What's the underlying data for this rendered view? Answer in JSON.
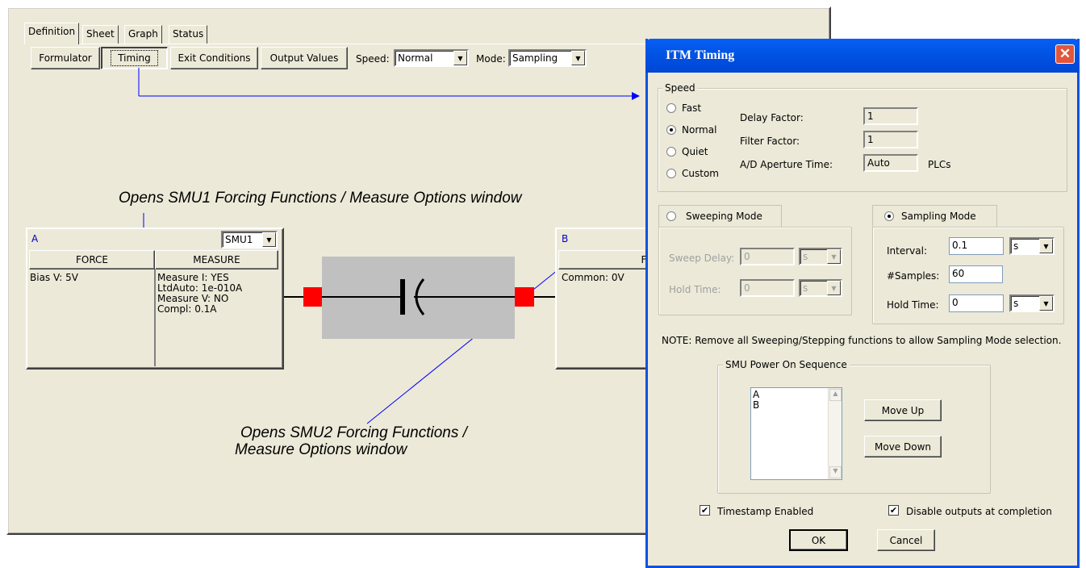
{
  "main": {
    "tabs": [
      "Definition",
      "Sheet",
      "Graph",
      "Status"
    ],
    "toolbar": {
      "formulator": "Formulator",
      "timing": "Timing",
      "exit_conditions": "Exit Conditions",
      "output_values": "Output Values",
      "speed_label": "Speed:",
      "speed_value": "Normal",
      "mode_label": "Mode:",
      "mode_value": "Sampling"
    },
    "annotations": {
      "smu1": "Opens SMU1 Forcing Functions / Measure Options window",
      "smu2_line1": "Opens SMU2 Forcing Functions /",
      "smu2_line2": "Measure Options window"
    },
    "smu_a": {
      "terminal": "A",
      "smu_select": "SMU1",
      "force_header": "FORCE",
      "measure_header": "MEASURE",
      "force_text": "Bias V: 5V",
      "measure_text": "Measure I: YES\nLtdAuto: 1e-010A\nMeasure V: NO\nCompl: 0.1A"
    },
    "smu_b": {
      "terminal": "B",
      "force_header": "FORC",
      "force_text": "Common: 0V"
    }
  },
  "dialog": {
    "title": "ITM Timing",
    "close_glyph": "✕",
    "speed_group": "Speed",
    "speed_options": [
      "Fast",
      "Normal",
      "Quiet",
      "Custom"
    ],
    "delay_factor_label": "Delay Factor:",
    "delay_factor_value": "1",
    "filter_factor_label": "Filter Factor:",
    "filter_factor_value": "1",
    "ad_aperture_label": "A/D Aperture Time:",
    "ad_aperture_value": "Auto",
    "ad_aperture_unit": "PLCs",
    "sweeping_mode": "Sweeping Mode",
    "sweep_delay_label": "Sweep Delay:",
    "sweep_delay_value": "0",
    "sweep_delay_unit": "s",
    "sweep_hold_label": "Hold Time:",
    "sweep_hold_value": "0",
    "sweep_hold_unit": "s",
    "sampling_mode": "Sampling Mode",
    "interval_label": "Interval:",
    "interval_value": "0.1",
    "interval_unit": "s",
    "samples_label": "#Samples:",
    "samples_value": "60",
    "hold_label": "Hold Time:",
    "hold_value": "0",
    "hold_unit": "s",
    "note": "NOTE: Remove all Sweeping/Stepping functions to allow Sampling Mode selection.",
    "power_on_group": "SMU Power On Sequence",
    "power_on_list": [
      "A",
      "B"
    ],
    "move_up": "Move Up",
    "move_down": "Move Down",
    "timestamp_label": "Timestamp Enabled",
    "disable_outputs_label": "Disable outputs at completion",
    "check_glyph": "✔",
    "ok": "OK",
    "cancel": "Cancel"
  },
  "colors": {
    "annotation_arrow": "#0000ff",
    "terminal_red": "#ff0000",
    "device_gray": "#c0c0c0",
    "titlebar_blue": "#0055e5"
  }
}
